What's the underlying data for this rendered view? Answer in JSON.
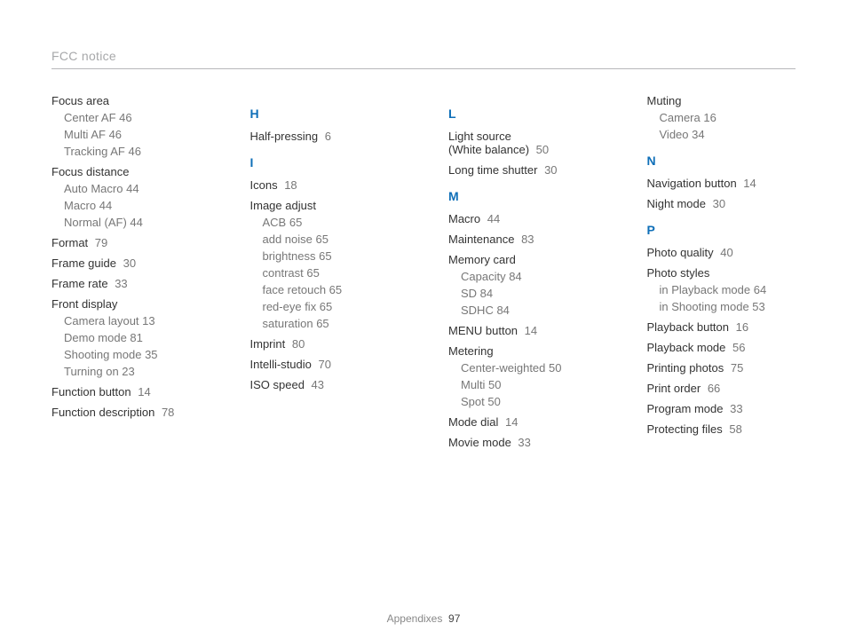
{
  "header": "FCC notice",
  "footer": {
    "label": "Appendixes",
    "page": "97"
  },
  "columns": [
    {
      "groups": [
        {
          "letter": null,
          "entries": [
            {
              "title": "Focus area",
              "page": null,
              "subs": [
                {
                  "label": "Center AF",
                  "page": "46"
                },
                {
                  "label": "Multi AF",
                  "page": "46"
                },
                {
                  "label": "Tracking AF",
                  "page": "46"
                }
              ]
            },
            {
              "title": "Focus distance",
              "page": null,
              "subs": [
                {
                  "label": "Auto Macro",
                  "page": "44"
                },
                {
                  "label": "Macro",
                  "page": "44"
                },
                {
                  "label": "Normal (AF)",
                  "page": "44"
                }
              ]
            },
            {
              "title": "Format",
              "page": "79",
              "subs": []
            },
            {
              "title": "Frame guide",
              "page": "30",
              "subs": []
            },
            {
              "title": "Frame rate",
              "page": "33",
              "subs": []
            },
            {
              "title": "Front display",
              "page": null,
              "subs": [
                {
                  "label": "Camera layout",
                  "page": "13"
                },
                {
                  "label": "Demo mode",
                  "page": "81"
                },
                {
                  "label": "Shooting mode",
                  "page": "35"
                },
                {
                  "label": "Turning on",
                  "page": "23"
                }
              ]
            },
            {
              "title": "Function button",
              "page": "14",
              "subs": []
            },
            {
              "title": "Function description",
              "page": "78",
              "subs": []
            }
          ]
        }
      ]
    },
    {
      "groups": [
        {
          "letter": "H",
          "entries": [
            {
              "title": "Half-pressing",
              "page": "6",
              "subs": []
            }
          ]
        },
        {
          "letter": "I",
          "entries": [
            {
              "title": "Icons",
              "page": "18",
              "subs": []
            },
            {
              "title": "Image adjust",
              "page": null,
              "subs": [
                {
                  "label": "ACB",
                  "page": "65"
                },
                {
                  "label": "add noise",
                  "page": "65"
                },
                {
                  "label": "brightness",
                  "page": "65"
                },
                {
                  "label": "contrast",
                  "page": "65"
                },
                {
                  "label": "face retouch",
                  "page": "65"
                },
                {
                  "label": "red-eye fix",
                  "page": "65"
                },
                {
                  "label": "saturation",
                  "page": "65"
                }
              ]
            },
            {
              "title": "Imprint",
              "page": "80",
              "subs": []
            },
            {
              "title": "Intelli-studio",
              "page": "70",
              "subs": []
            },
            {
              "title": "ISO speed",
              "page": "43",
              "subs": []
            }
          ]
        }
      ]
    },
    {
      "groups": [
        {
          "letter": "L",
          "entries": [
            {
              "title": "Light source\n(White balance)",
              "page": "50",
              "subs": []
            },
            {
              "title": "Long time shutter",
              "page": "30",
              "subs": []
            }
          ]
        },
        {
          "letter": "M",
          "entries": [
            {
              "title": "Macro",
              "page": "44",
              "subs": []
            },
            {
              "title": "Maintenance",
              "page": "83",
              "subs": []
            },
            {
              "title": "Memory card",
              "page": null,
              "subs": [
                {
                  "label": "Capacity",
                  "page": "84"
                },
                {
                  "label": "SD",
                  "page": "84"
                },
                {
                  "label": "SDHC",
                  "page": "84"
                }
              ]
            },
            {
              "title": "MENU button",
              "page": "14",
              "subs": []
            },
            {
              "title": "Metering",
              "page": null,
              "subs": [
                {
                  "label": "Center-weighted",
                  "page": "50"
                },
                {
                  "label": "Multi",
                  "page": "50"
                },
                {
                  "label": "Spot",
                  "page": "50"
                }
              ]
            },
            {
              "title": "Mode dial",
              "page": "14",
              "subs": []
            },
            {
              "title": "Movie mode",
              "page": "33",
              "subs": []
            }
          ]
        }
      ]
    },
    {
      "groups": [
        {
          "letter": null,
          "entries": [
            {
              "title": "Muting",
              "page": null,
              "subs": [
                {
                  "label": "Camera",
                  "page": "16"
                },
                {
                  "label": "Video",
                  "page": "34"
                }
              ]
            }
          ]
        },
        {
          "letter": "N",
          "entries": [
            {
              "title": "Navigation button",
              "page": "14",
              "subs": []
            },
            {
              "title": "Night mode",
              "page": "30",
              "subs": []
            }
          ]
        },
        {
          "letter": "P",
          "entries": [
            {
              "title": "Photo quality",
              "page": "40",
              "subs": []
            },
            {
              "title": "Photo styles",
              "page": null,
              "subs": [
                {
                  "label": "in Playback mode",
                  "page": "64"
                },
                {
                  "label": "in Shooting mode",
                  "page": "53"
                }
              ]
            },
            {
              "title": "Playback button",
              "page": "16",
              "subs": []
            },
            {
              "title": "Playback mode",
              "page": "56",
              "subs": []
            },
            {
              "title": "Printing photos",
              "page": "75",
              "subs": []
            },
            {
              "title": "Print order",
              "page": "66",
              "subs": []
            },
            {
              "title": "Program mode",
              "page": "33",
              "subs": []
            },
            {
              "title": "Protecting files",
              "page": "58",
              "subs": []
            }
          ]
        }
      ]
    }
  ]
}
